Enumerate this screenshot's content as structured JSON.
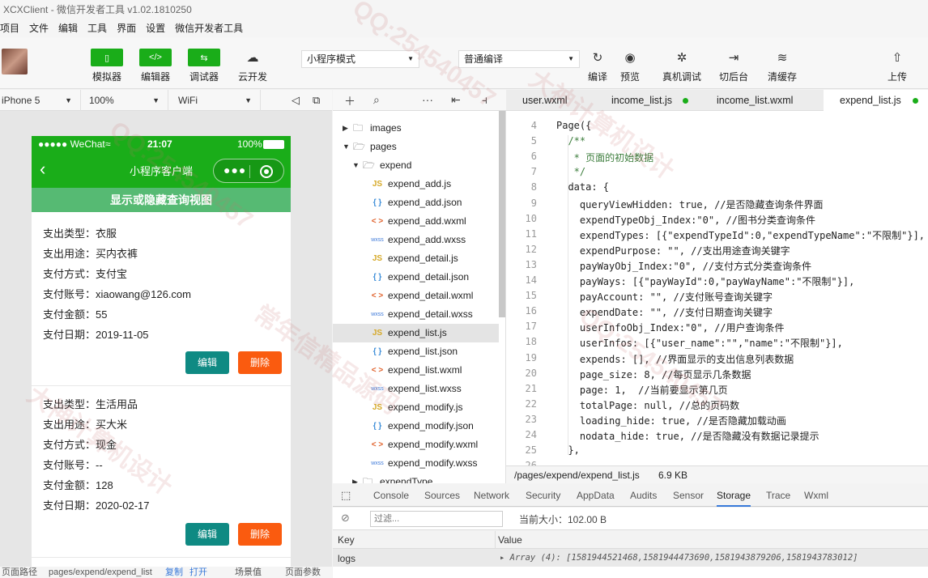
{
  "app": {
    "title": "XCXClient - 微信开发者工具 v1.02.1810250"
  },
  "menu": [
    "项目",
    "文件",
    "编辑",
    "工具",
    "界面",
    "设置",
    "微信开发者工具"
  ],
  "toolbar": {
    "simulator": "模拟器",
    "editor": "编辑器",
    "debugger": "调试器",
    "cloud": "云开发",
    "mode_select": "小程序模式",
    "compile_select": "普通编译",
    "compile": "编译",
    "preview": "预览",
    "remote_debug": "真机调试",
    "background": "切后台",
    "clear_cache": "清缓存",
    "upload": "上传"
  },
  "device": {
    "model": "iPhone 5",
    "zoom": "100%",
    "network": "WiFi"
  },
  "phone": {
    "carrier": "●●●●● WeChat",
    "time": "21:07",
    "battery": "100%",
    "nav_title": "小程序客户端",
    "toggle_button": "显示或隐藏查询视图",
    "records": [
      {
        "type": "支出类型：衣服",
        "purpose": "支出用途：买内衣裤",
        "method": "支付方式：支付宝",
        "account": "支付账号：xiaowang@126.com",
        "amount": "支付金额：55",
        "date": "支付日期：2019-11-05"
      },
      {
        "type": "支出类型：生活用品",
        "purpose": "支出用途：买大米",
        "method": "支付方式：现金",
        "account": "支付账号：--",
        "amount": "支付金额：128",
        "date": "支付日期：2020-02-17"
      }
    ],
    "edit_label": "编辑",
    "delete_label": "删除"
  },
  "sim_footer": {
    "path_label": "页面路径",
    "path": "pages/expend/expend_list",
    "copy": "复制",
    "open": "打开",
    "scene": "场景值",
    "params": "页面参数"
  },
  "tree": [
    {
      "label": "images",
      "kind": "folder",
      "depth": 0,
      "open": false
    },
    {
      "label": "pages",
      "kind": "folder",
      "depth": 0,
      "open": true
    },
    {
      "label": "expend",
      "kind": "folder",
      "depth": 1,
      "open": true
    },
    {
      "label": "expend_add.js",
      "kind": "js",
      "depth": 2
    },
    {
      "label": "expend_add.json",
      "kind": "json",
      "depth": 2
    },
    {
      "label": "expend_add.wxml",
      "kind": "wxml",
      "depth": 2
    },
    {
      "label": "expend_add.wxss",
      "kind": "wxss",
      "depth": 2
    },
    {
      "label": "expend_detail.js",
      "kind": "js",
      "depth": 2
    },
    {
      "label": "expend_detail.json",
      "kind": "json",
      "depth": 2
    },
    {
      "label": "expend_detail.wxml",
      "kind": "wxml",
      "depth": 2
    },
    {
      "label": "expend_detail.wxss",
      "kind": "wxss",
      "depth": 2
    },
    {
      "label": "expend_list.js",
      "kind": "js",
      "depth": 2,
      "selected": true
    },
    {
      "label": "expend_list.json",
      "kind": "json",
      "depth": 2
    },
    {
      "label": "expend_list.wxml",
      "kind": "wxml",
      "depth": 2
    },
    {
      "label": "expend_list.wxss",
      "kind": "wxss",
      "depth": 2
    },
    {
      "label": "expend_modify.js",
      "kind": "js",
      "depth": 2
    },
    {
      "label": "expend_modify.json",
      "kind": "json",
      "depth": 2
    },
    {
      "label": "expend_modify.wxml",
      "kind": "wxml",
      "depth": 2
    },
    {
      "label": "expend_modify.wxss",
      "kind": "wxss",
      "depth": 2
    },
    {
      "label": "expendType",
      "kind": "folder",
      "depth": 1,
      "open": false
    }
  ],
  "file_icons": {
    "js": "JS",
    "json": "{ }",
    "wxml": "< >",
    "wxss": "wxss"
  },
  "tabs": [
    {
      "label": "user.wxml",
      "dot": false
    },
    {
      "label": "income_list.js",
      "dot": true
    },
    {
      "label": "income_list.wxml",
      "dot": false
    },
    {
      "label": "expend_list.js",
      "dot": true,
      "active": true
    }
  ],
  "code_lines": [
    {
      "n": "4",
      "t": "Page({",
      "c": ""
    },
    {
      "n": "5",
      "t": "  /**",
      "c": "cmt"
    },
    {
      "n": "6",
      "t": "   * 页面的初始数据",
      "c": "cmt"
    },
    {
      "n": "7",
      "t": "   */",
      "c": "cmt"
    },
    {
      "n": "8",
      "t": "  data: {",
      "c": ""
    },
    {
      "n": "9",
      "t": "    queryViewHidden: true, //是否隐藏查询条件界面",
      "c": ""
    },
    {
      "n": "10",
      "t": "    expendTypeObj_Index:\"0\", //图书分类查询条件",
      "c": ""
    },
    {
      "n": "11",
      "t": "    expendTypes: [{\"expendTypeId\":0,\"expendTypeName\":\"不限制\"}],",
      "c": ""
    },
    {
      "n": "12",
      "t": "    expendPurpose: \"\", //支出用途查询关键字",
      "c": ""
    },
    {
      "n": "13",
      "t": "    payWayObj_Index:\"0\", //支付方式分类查询条件",
      "c": ""
    },
    {
      "n": "14",
      "t": "    payWays: [{\"payWayId\":0,\"payWayName\":\"不限制\"}],",
      "c": ""
    },
    {
      "n": "15",
      "t": "    payAccount: \"\", //支付账号查询关键字",
      "c": ""
    },
    {
      "n": "16",
      "t": "    expendDate: \"\", //支付日期查询关键字",
      "c": ""
    },
    {
      "n": "17",
      "t": "    userInfoObj_Index:\"0\", //用户查询条件",
      "c": ""
    },
    {
      "n": "18",
      "t": "    userInfos: [{\"user_name\":\"\",\"name\":\"不限制\"}],",
      "c": ""
    },
    {
      "n": "19",
      "t": "    expends: [], //界面显示的支出信息列表数据",
      "c": ""
    },
    {
      "n": "20",
      "t": "    page_size: 8, //每页显示几条数据",
      "c": ""
    },
    {
      "n": "21",
      "t": "    page: 1,  //当前要显示第几页",
      "c": ""
    },
    {
      "n": "22",
      "t": "    totalPage: null, //总的页码数",
      "c": ""
    },
    {
      "n": "23",
      "t": "    loading_hide: true, //是否隐藏加载动画",
      "c": ""
    },
    {
      "n": "24",
      "t": "    nodata_hide: true, //是否隐藏没有数据记录提示",
      "c": ""
    },
    {
      "n": "25",
      "t": "  },",
      "c": ""
    },
    {
      "n": "26",
      "t": "",
      "c": ""
    }
  ],
  "editor_status": {
    "path": "/pages/expend/expend_list.js",
    "size": "6.9 KB"
  },
  "devtools": {
    "tabs": [
      "Console",
      "Sources",
      "Network",
      "Security",
      "AppData",
      "Audits",
      "Sensor",
      "Storage",
      "Trace",
      "Wxml"
    ],
    "active": "Storage",
    "filter_placeholder": "过滤...",
    "current_size": "当前大小：102.00 B",
    "key_header": "Key",
    "value_header": "Value",
    "key": "logs",
    "value": "▸ Array (4): [1581944521468,1581944473690,1581943879206,1581943783012]"
  },
  "watermark": {
    "qq": "QQ:254540457",
    "brand": "大神计算机设计",
    "brand2": "常年信精品源码"
  }
}
